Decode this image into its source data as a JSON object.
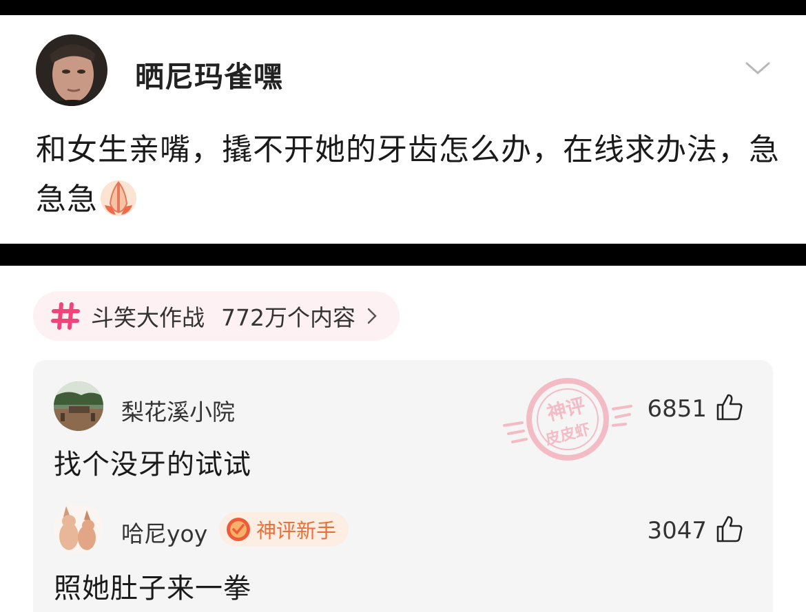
{
  "post": {
    "username": "晒尼玛雀嘿",
    "text": "和女生亲嘴，撬不开她的牙齿怎么办，在线求办法，急急急"
  },
  "topic": {
    "name": "斗笑大作战",
    "count": "772万个内容"
  },
  "comments": [
    {
      "username": "梨花溪小院",
      "text": "找个没牙的试试",
      "likes": "6851"
    },
    {
      "username": "哈尼yoy",
      "badge": "神评新手",
      "text": "照她肚子来一拳",
      "likes": "3047"
    }
  ],
  "stamp": {
    "line1": "神评",
    "line2": "皮皮虾"
  },
  "colors": {
    "topic_hash": "#f0447a",
    "badge_text": "#e8703a",
    "stamp": "#f3a9b6"
  }
}
